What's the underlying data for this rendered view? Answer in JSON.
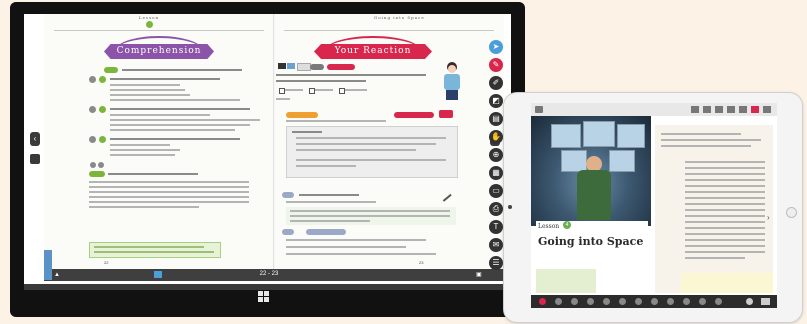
{
  "tablet": {
    "left_page": {
      "section_title": "Comprehension",
      "lesson_tab": "Lesson",
      "page_number": "22"
    },
    "right_page": {
      "section_title": "Your Reaction",
      "header_tab": "Going into Space",
      "page_number": "23"
    },
    "page_indicator": "22 - 23"
  },
  "ipad": {
    "lesson_label": "Lesson",
    "lesson_number": "4",
    "lesson_title": "Going into Space"
  },
  "colors": {
    "comprehension_banner": "#8b54a8",
    "reaction_banner": "#d9264d",
    "accent_green": "#7bb63b",
    "tool_blue": "#4aa3d8"
  },
  "icons": {
    "right_toolbar": [
      "pointer-icon",
      "pen-icon",
      "highlighter-icon",
      "eraser-icon",
      "page-icon",
      "hand-icon",
      "zoom-icon",
      "grid-icon",
      "window-icon",
      "print-icon",
      "text-icon",
      "comment-icon",
      "list-icon",
      "cursor-icon"
    ],
    "left_toolbar": [
      "prev-page-icon",
      "pages-icon"
    ],
    "windows_key": "windows-logo-icon"
  }
}
